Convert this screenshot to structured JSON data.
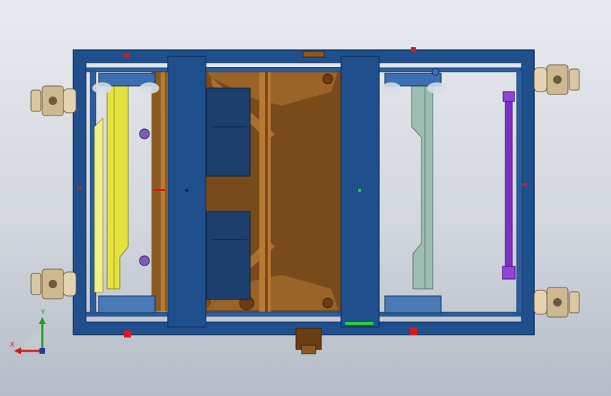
{
  "scene": {
    "description_free": true,
    "colors": {
      "frame_blue": "#1f4f8c",
      "frame_blue_dark": "#0f2f5c",
      "frame_edge": "#8aa6c9",
      "brown": "#8a5a22",
      "brown_light": "#b77a34",
      "yellow_panel": "#e4e23c",
      "teal_panel": "#8fb2a7",
      "purple_strut": "#7a2fc6",
      "caster_beige": "#d9c6a2",
      "red_marker": "#d21d1d"
    },
    "icons": {
      "caster": "caster-wheel-icon",
      "axis": "axis-triad-icon"
    }
  },
  "triad": {
    "x_label": "X",
    "y_label": "Y"
  }
}
